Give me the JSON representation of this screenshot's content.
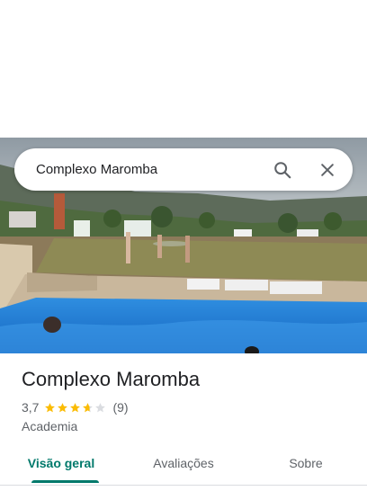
{
  "search": {
    "query": "Complexo Maromba"
  },
  "place": {
    "name": "Complexo Maromba",
    "rating": "3,7",
    "rating_fraction": 0.74,
    "review_count": "(9)",
    "category": "Academia"
  },
  "tabs": [
    {
      "label": "Visão geral",
      "active": true
    },
    {
      "label": "Avaliações",
      "active": false
    },
    {
      "label": "Sobre",
      "active": false
    }
  ],
  "colors": {
    "accent": "#00796b",
    "star": "#fbbc04",
    "star_empty": "#dadce0",
    "pool": "#1e88e5"
  },
  "icons": {
    "search": "search-icon",
    "close": "close-icon",
    "star": "star-icon"
  }
}
